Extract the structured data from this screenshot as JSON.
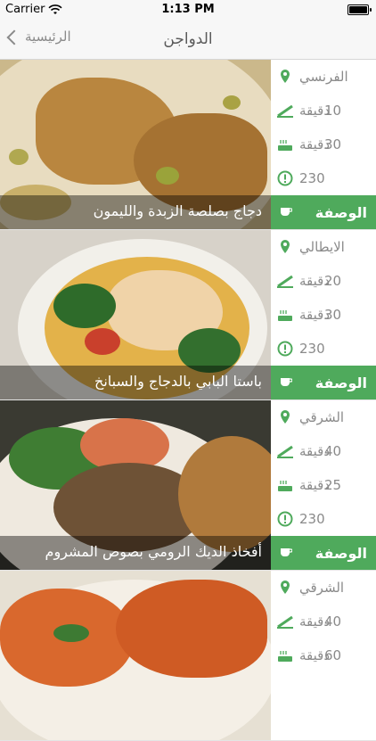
{
  "status": {
    "carrier": "Carrier",
    "time": "1:13 PM"
  },
  "nav": {
    "title": "الدواجن",
    "back_label": "الرئيسية"
  },
  "colors": {
    "accent": "#4faa5c",
    "muted": "#8a8a8a"
  },
  "recipes": [
    {
      "title": "دجاج بصلصة الزبدة والليمون",
      "cuisine": "الفرنسي",
      "prep": "10",
      "cook": "30",
      "unit": "دقيقة",
      "calories": "230",
      "recipe_label": "الوصفة"
    },
    {
      "title": "باستا البابي بالدجاج والسبانخ",
      "cuisine": "الايطالي",
      "prep": "20",
      "cook": "30",
      "unit": "دقيقة",
      "calories": "230",
      "recipe_label": "الوصفة"
    },
    {
      "title": "أفخاذ الديك الرومي بصوص المشروم",
      "cuisine": "الشرقي",
      "prep": "40",
      "cook": "25",
      "unit": "دقيقة",
      "calories": "230",
      "recipe_label": "الوصفة"
    },
    {
      "title": "",
      "cuisine": "الشرقي",
      "prep": "40",
      "cook": "60",
      "unit": "دقيقة",
      "calories": "",
      "recipe_label": ""
    }
  ]
}
